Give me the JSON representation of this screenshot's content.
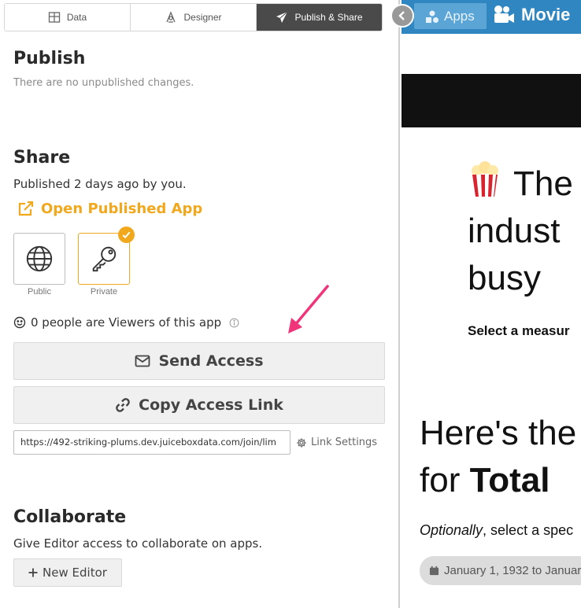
{
  "tabs": [
    {
      "label": "Data",
      "icon": "table-icon",
      "active": false
    },
    {
      "label": "Designer",
      "icon": "designer-icon",
      "active": false
    },
    {
      "label": "Publish & Share",
      "icon": "paper-plane-icon",
      "active": true
    }
  ],
  "publish": {
    "title": "Publish",
    "status": "There are no unpublished changes."
  },
  "share": {
    "title": "Share",
    "published_info": "Published 2 days ago by you.",
    "open_link_label": "Open Published App",
    "access_options": [
      {
        "label": "Public",
        "icon": "globe-icon",
        "selected": false
      },
      {
        "label": "Private",
        "icon": "key-icon",
        "selected": true
      }
    ],
    "viewers_text": "0 people are Viewers of this app",
    "send_access_label": "Send Access",
    "copy_link_label": "Copy Access Link",
    "access_link_value": "https://492-striking-plums.dev.juiceboxdata.com/join/lim",
    "link_settings_label": "Link Settings"
  },
  "collaborate": {
    "title": "Collaborate",
    "description": "Give Editor access to collaborate on apps.",
    "new_editor_label": "New Editor"
  },
  "preview": {
    "apps_label": "Apps",
    "app_title": "Movie",
    "hero_lines": [
      "The",
      "indust",
      "busy"
    ],
    "select_measure": "Select a measur",
    "heres_lines": [
      "Here's the",
      "for "
    ],
    "heres_bold": "Total",
    "optional_italic": "Optionally",
    "optional_rest": ", select a spec",
    "date_range": "January 1, 1932 to Januar"
  },
  "colors": {
    "accent": "#f2a81d",
    "active_tab": "#4a4a4a",
    "topbar": "#2f86c0",
    "arrow": "#f0357a"
  }
}
